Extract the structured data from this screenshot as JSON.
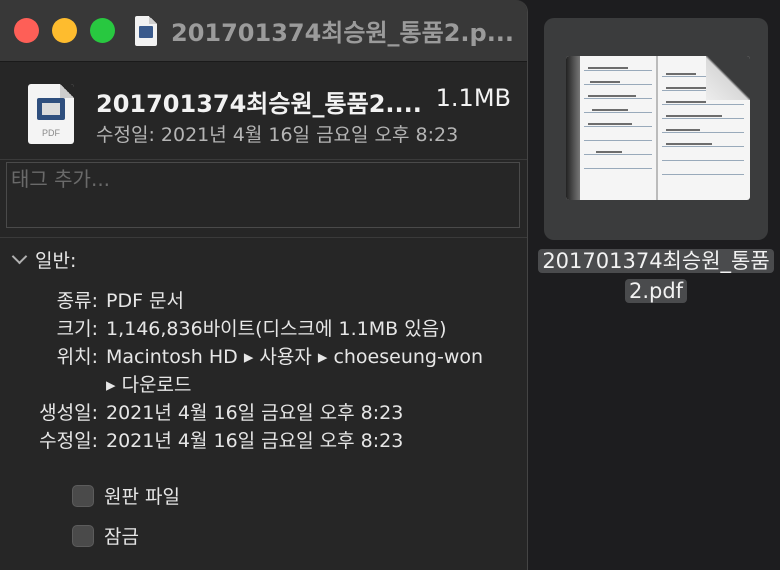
{
  "window": {
    "title": "201701374최승원_통품2.p..."
  },
  "header": {
    "file_name": "201701374최승원_통품2....",
    "file_size": "1.1MB",
    "icon_label": "PDF",
    "modified_label": "수정일:",
    "modified_value": "2021년 4월 16일 금요일 오후 8:23"
  },
  "tags": {
    "placeholder": "태그 추가..."
  },
  "general": {
    "section_title": "일반:",
    "rows": [
      {
        "key": "종류:",
        "value": "PDF 문서"
      },
      {
        "key": "크기:",
        "value": "1,146,836바이트(디스크에 1.1MB 있음)"
      },
      {
        "key": "위치:",
        "value": "Macintosh HD ▸ 사용자 ▸ choeseung-won ▸ 다운로드"
      },
      {
        "key": "생성일:",
        "value": "2021년 4월 16일 금요일 오후 8:23"
      },
      {
        "key": "수정일:",
        "value": "2021년 4월 16일 금요일 오후 8:23"
      }
    ],
    "checkboxes": [
      {
        "label": "원판 파일",
        "checked": false
      },
      {
        "label": "잠금",
        "checked": false
      }
    ]
  },
  "desktop": {
    "file_label": "201701374최승원_통품2.pdf"
  }
}
